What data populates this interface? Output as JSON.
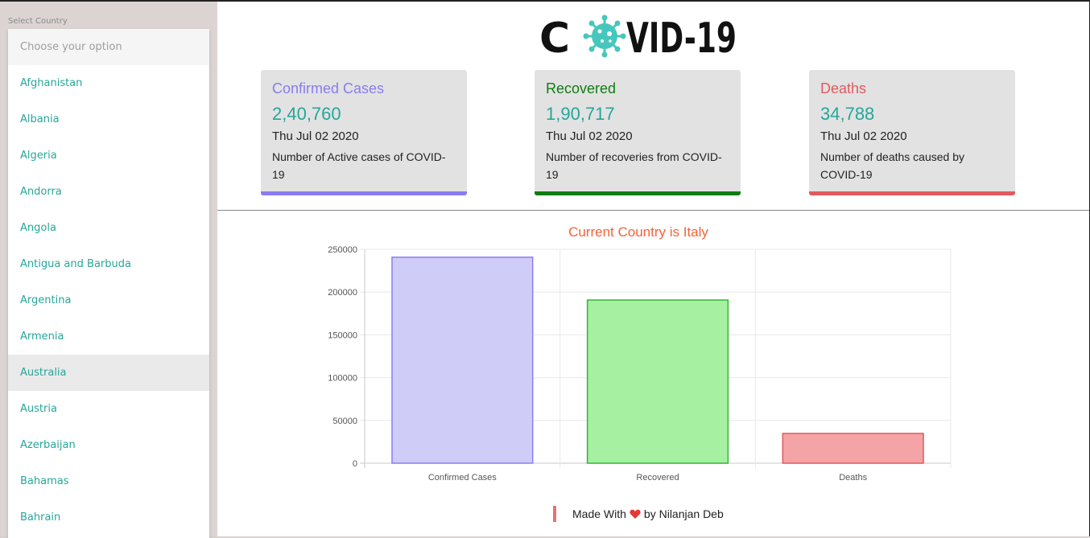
{
  "sidebar": {
    "label": "Select Country",
    "placeholder": "Choose your option",
    "hovered_country": "Australia",
    "countries": [
      "Afghanistan",
      "Albania",
      "Algeria",
      "Andorra",
      "Angola",
      "Antigua and Barbuda",
      "Argentina",
      "Armenia",
      "Australia",
      "Austria",
      "Azerbaijan",
      "Bahamas",
      "Bahrain"
    ]
  },
  "header": {
    "logo_text": "COVID-19"
  },
  "cards": [
    {
      "title": "Confirmed Cases",
      "value": "2,40,760",
      "date": "Thu Jul 02 2020",
      "description": "Number of Active cases of COVID-19",
      "color": "#8a7cf0"
    },
    {
      "title": "Recovered",
      "value": "1,90,717",
      "date": "Thu Jul 02 2020",
      "description": "Number of recoveries from COVID-19",
      "color": "#0f7d10"
    },
    {
      "title": "Deaths",
      "value": "34,788",
      "date": "Thu Jul 02 2020",
      "description": "Number of deaths caused by COVID-19",
      "color": "#e05a5f"
    }
  ],
  "chart_data": {
    "type": "bar",
    "title": "Current Country is Italy",
    "categories": [
      "Confirmed Cases",
      "Recovered",
      "Deaths"
    ],
    "values": [
      240760,
      190717,
      34788
    ],
    "ylim": [
      0,
      250000
    ],
    "yticks": [
      "250000",
      "200000",
      "150000",
      "100000",
      "50000",
      "0"
    ],
    "grid": true,
    "colors": {
      "fills": [
        "#d0ccf8",
        "#a6f0a2",
        "#f4a3a6"
      ],
      "strokes": [
        "#8b7ff0",
        "#36b43a",
        "#e05a5f"
      ]
    }
  },
  "footer": {
    "made_with": "Made With",
    "by": "by Nilanjan Deb",
    "heart_color": "#e53935"
  },
  "colors": {
    "accent": "#26a69a",
    "chart_title": "#f4623a"
  }
}
